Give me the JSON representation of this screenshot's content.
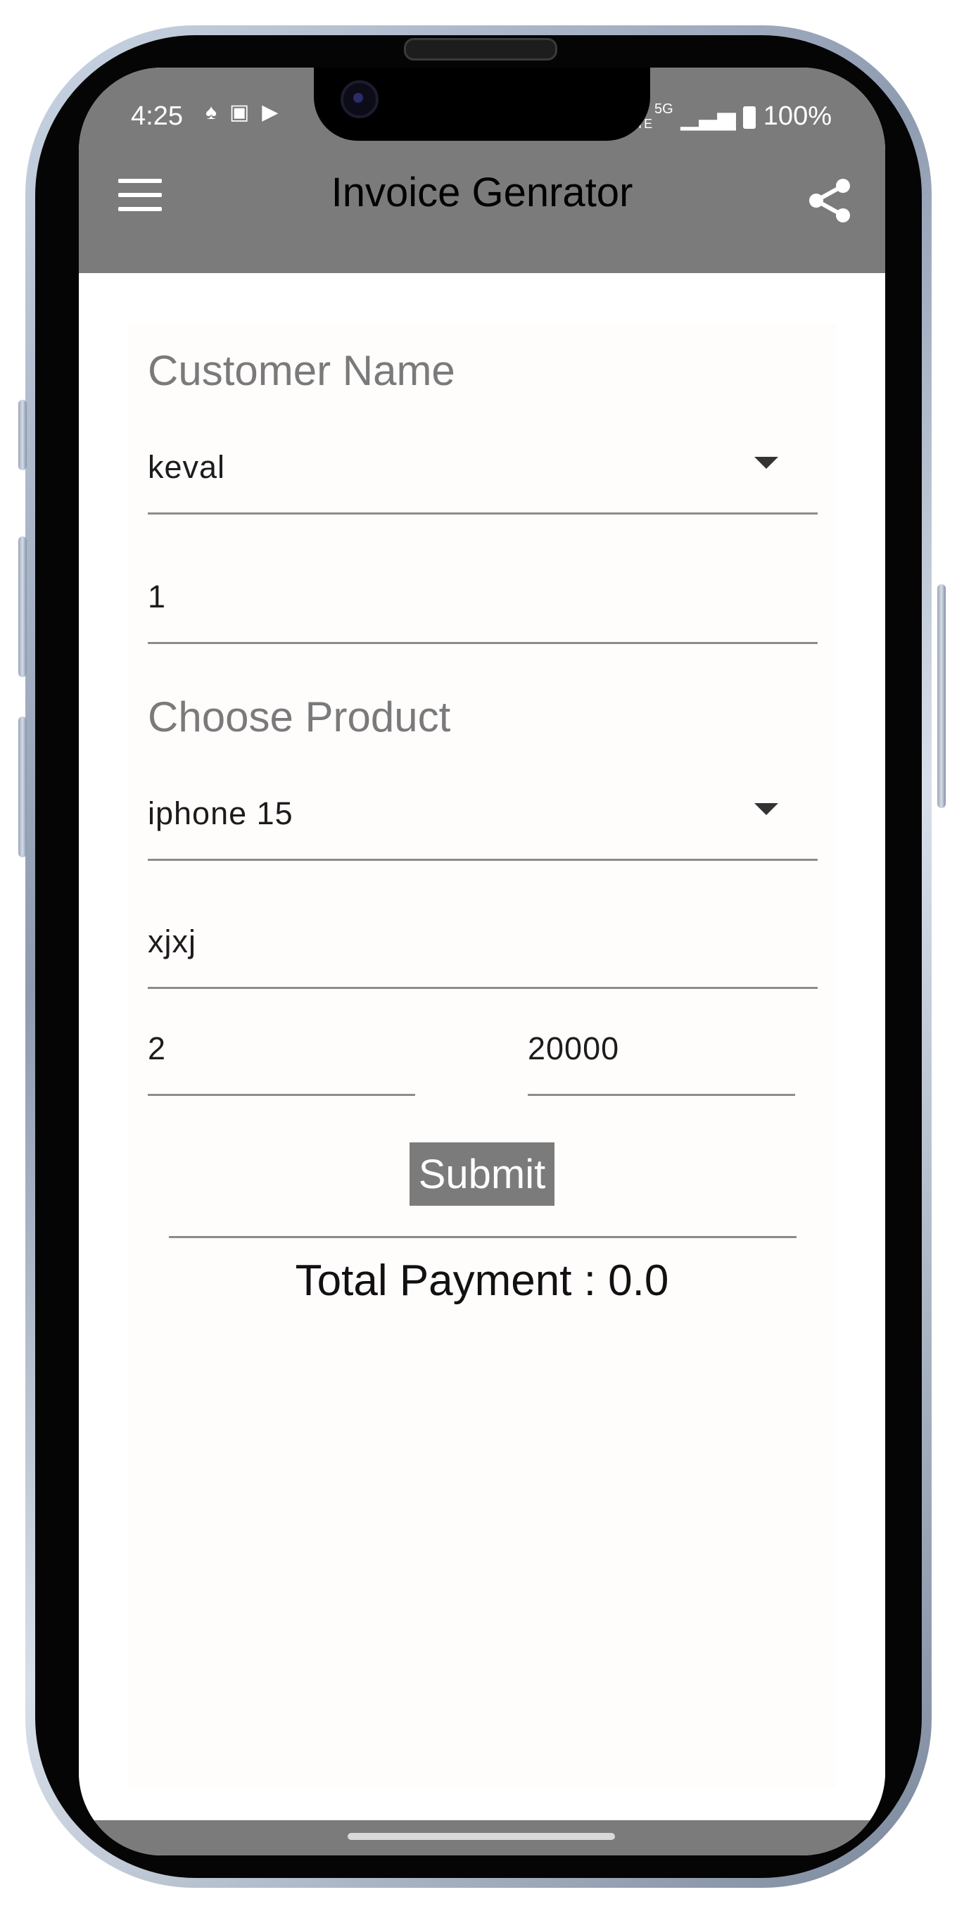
{
  "status_bar": {
    "time": "4:25",
    "notification_icons": [
      "snapchat-icon",
      "gallery-icon",
      "youtube-icon"
    ],
    "network_label": "Vo LTE",
    "signal_label": "5G",
    "battery": "100%"
  },
  "app_bar": {
    "title": "Invoice Genrator",
    "menu_icon": "hamburger-menu-icon",
    "share_icon": "share-icon",
    "color": "#7b7b7b"
  },
  "form": {
    "customer_label": "Customer Name",
    "customer_value": "keval",
    "invoice_number_value": "1",
    "product_label": "Choose Product",
    "product_value": "iphone 15",
    "description_value": "xjxj",
    "quantity_value": "2",
    "price_value": "20000",
    "submit_label": "Submit"
  },
  "summary": {
    "total_text": "Total Payment : 0.0"
  }
}
